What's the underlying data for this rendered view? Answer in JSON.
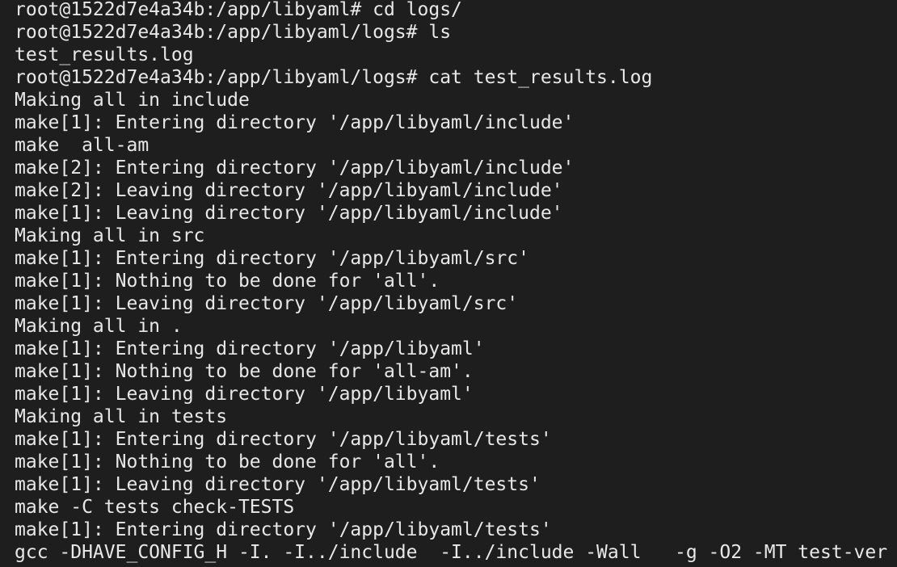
{
  "terminal": {
    "lines": [
      "root@1522d7e4a34b:/app/libyaml# cd logs/",
      "root@1522d7e4a34b:/app/libyaml/logs# ls",
      "test_results.log",
      "root@1522d7e4a34b:/app/libyaml/logs# cat test_results.log",
      "Making all in include",
      "make[1]: Entering directory '/app/libyaml/include'",
      "make  all-am",
      "make[2]: Entering directory '/app/libyaml/include'",
      "make[2]: Leaving directory '/app/libyaml/include'",
      "make[1]: Leaving directory '/app/libyaml/include'",
      "Making all in src",
      "make[1]: Entering directory '/app/libyaml/src'",
      "make[1]: Nothing to be done for 'all'.",
      "make[1]: Leaving directory '/app/libyaml/src'",
      "Making all in .",
      "make[1]: Entering directory '/app/libyaml'",
      "make[1]: Nothing to be done for 'all-am'.",
      "make[1]: Leaving directory '/app/libyaml'",
      "Making all in tests",
      "make[1]: Entering directory '/app/libyaml/tests'",
      "make[1]: Nothing to be done for 'all'.",
      "make[1]: Leaving directory '/app/libyaml/tests'",
      "make -C tests check-TESTS",
      "make[1]: Entering directory '/app/libyaml/tests'",
      "gcc -DHAVE_CONFIG_H -I. -I../include  -I../include -Wall   -g -O2 -MT test-ver"
    ]
  },
  "colors": {
    "background": "#1e1e1e",
    "foreground": "#e8e8e8"
  }
}
